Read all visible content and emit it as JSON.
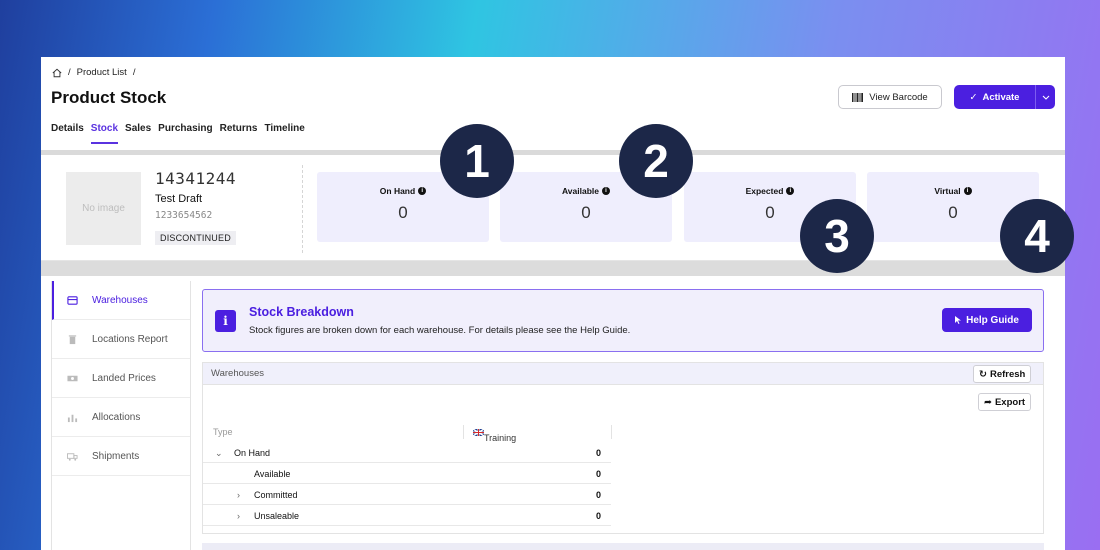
{
  "breadcrumb": {
    "items": [
      "Product List",
      "/"
    ]
  },
  "page": {
    "title": "Product Stock"
  },
  "tabs": [
    "Details",
    "Stock",
    "Sales",
    "Purchasing",
    "Returns",
    "Timeline"
  ],
  "header_actions": {
    "view_barcode": "View Barcode",
    "activate": "Activate"
  },
  "product": {
    "image_placeholder": "No image",
    "sku": "14341244",
    "name": "Test Draft",
    "code": "1233654562",
    "status_badge": "DISCONTINUED"
  },
  "stats": [
    {
      "label": "On Hand",
      "value": "0"
    },
    {
      "label": "Available",
      "value": "0"
    },
    {
      "label": "Expected",
      "value": "0"
    },
    {
      "label": "Virtual",
      "value": "0"
    }
  ],
  "side_menu": [
    {
      "label": "Warehouses",
      "icon": "warehouse-icon"
    },
    {
      "label": "Locations Report",
      "icon": "trash-icon"
    },
    {
      "label": "Landed Prices",
      "icon": "cash-icon"
    },
    {
      "label": "Allocations",
      "icon": "bars-icon"
    },
    {
      "label": "Shipments",
      "icon": "truck-icon"
    }
  ],
  "banner": {
    "title": "Stock Breakdown",
    "subtitle": "Stock figures are broken down for each warehouse. For details please see the Help Guide.",
    "help_button": "Help Guide"
  },
  "warehouses": {
    "title": "Warehouses",
    "refresh": "Refresh",
    "export": "Export",
    "col_type": "Type",
    "col_warehouse": "Training",
    "rows": [
      {
        "label": "On Hand",
        "value": "0"
      },
      {
        "label": "Available",
        "value": "0"
      },
      {
        "label": "Committed",
        "value": "0"
      },
      {
        "label": "Unsaleable",
        "value": "0"
      }
    ]
  },
  "callouts": [
    "1",
    "2",
    "3",
    "4"
  ],
  "colors": {
    "accent": "#4b1fe0",
    "callout": "#1c2748",
    "stat_bg": "#efeefd"
  }
}
